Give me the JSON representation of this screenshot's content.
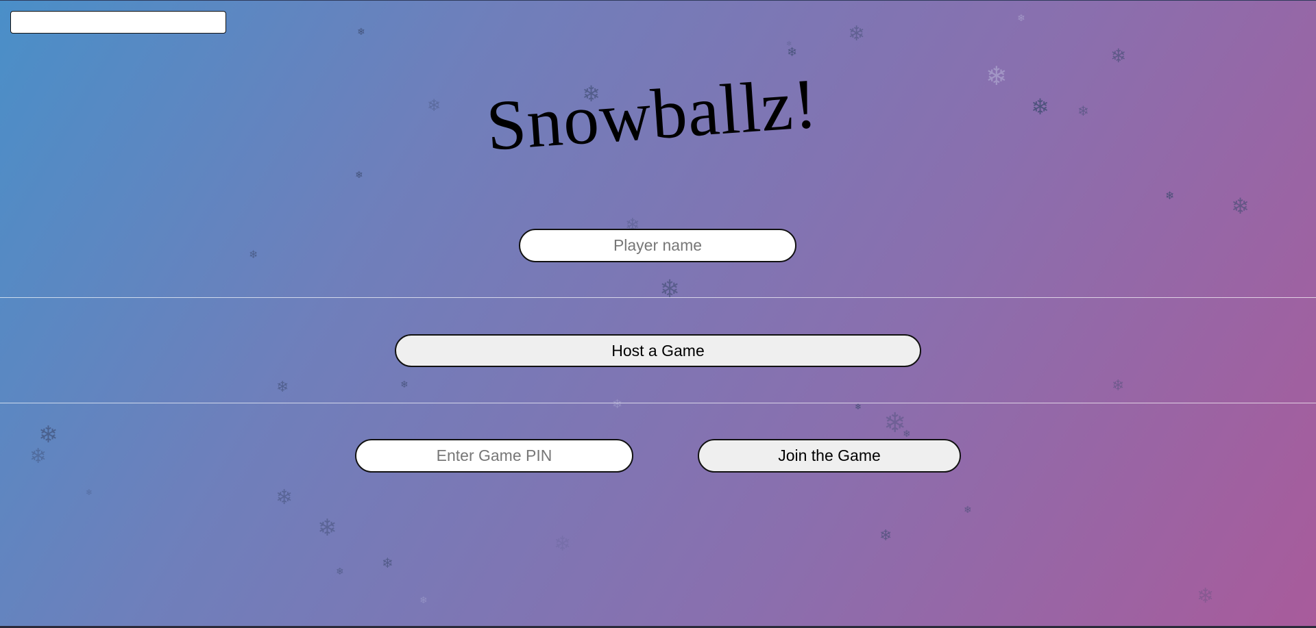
{
  "title": "Snowballz!",
  "player_name": {
    "placeholder": "Player name",
    "value": ""
  },
  "host_button": {
    "label": "Host a Game"
  },
  "game_pin": {
    "placeholder": "Enter Game PIN",
    "value": ""
  },
  "join_button": {
    "label": "Join the Game"
  },
  "colors": {
    "gradient_start": "#4a8fc8",
    "gradient_end": "#a85b9b",
    "snowflake_dark": "#3c4a6e",
    "snowflake_light": "#c9cde6"
  },
  "icons": {
    "snowflake": "snowflake-icon"
  }
}
